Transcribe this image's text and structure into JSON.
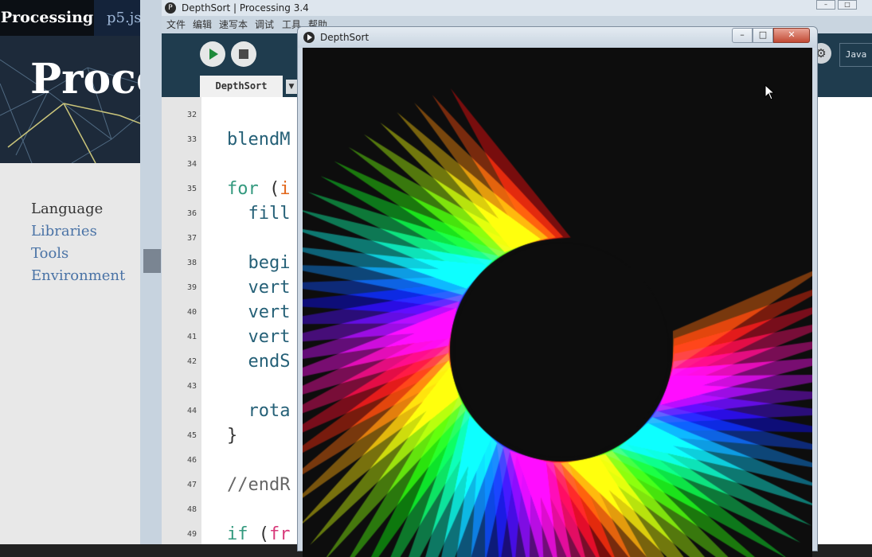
{
  "browser": {
    "nav": {
      "processing": "Processing",
      "p5": "p5.js"
    },
    "banner_title": "Proce",
    "menu": [
      {
        "label": "Language",
        "active": true
      },
      {
        "label": "Libraries",
        "active": false
      },
      {
        "label": "Tools",
        "active": false
      },
      {
        "label": "Environment",
        "active": false
      }
    ]
  },
  "ide": {
    "window_title": "DepthSort | Processing 3.4",
    "menu": [
      "文件",
      "编辑",
      "速写本",
      "调试",
      "工具",
      "帮助"
    ],
    "tab": "DepthSort",
    "mode": "Java",
    "lines": [
      {
        "num": "32",
        "code": ""
      },
      {
        "num": "33",
        "code": "blendM"
      },
      {
        "num": "34",
        "code": ""
      },
      {
        "num": "35",
        "code": "for (i"
      },
      {
        "num": "36",
        "code": "  fill"
      },
      {
        "num": "37",
        "code": ""
      },
      {
        "num": "38",
        "code": "  begi"
      },
      {
        "num": "39",
        "code": "  vert"
      },
      {
        "num": "40",
        "code": "  vert"
      },
      {
        "num": "41",
        "code": "  vert"
      },
      {
        "num": "42",
        "code": "  endS"
      },
      {
        "num": "43",
        "code": ""
      },
      {
        "num": "44",
        "code": "  rota"
      },
      {
        "num": "45",
        "code": "}"
      },
      {
        "num": "46",
        "code": ""
      },
      {
        "num": "47",
        "code": "//endR"
      },
      {
        "num": "48",
        "code": ""
      },
      {
        "num": "49",
        "code": "if (fr"
      }
    ]
  },
  "sketch": {
    "title": "DepthSort",
    "background": "#0d0d0d"
  }
}
